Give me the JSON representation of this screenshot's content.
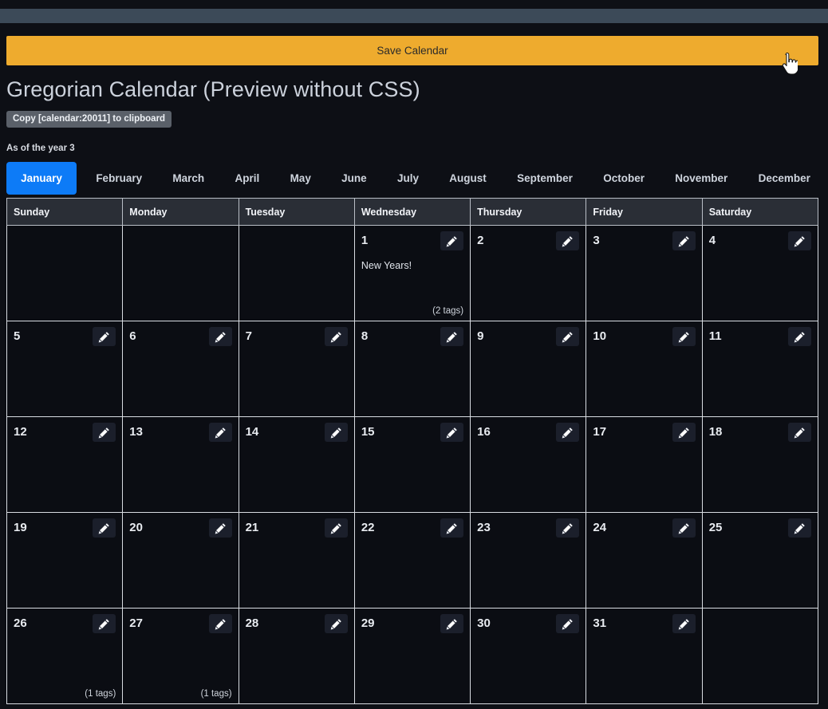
{
  "toolbar": {
    "save_label": "Save Calendar"
  },
  "header": {
    "title": "Gregorian Calendar (Preview without CSS)",
    "copy_label": "Copy [calendar:20011] to clipboard",
    "year_note": "As of the year 3"
  },
  "months": [
    {
      "label": "January",
      "active": true
    },
    {
      "label": "February",
      "active": false
    },
    {
      "label": "March",
      "active": false
    },
    {
      "label": "April",
      "active": false
    },
    {
      "label": "May",
      "active": false
    },
    {
      "label": "June",
      "active": false
    },
    {
      "label": "July",
      "active": false
    },
    {
      "label": "August",
      "active": false
    },
    {
      "label": "September",
      "active": false
    },
    {
      "label": "October",
      "active": false
    },
    {
      "label": "November",
      "active": false
    },
    {
      "label": "December",
      "active": false
    }
  ],
  "weekday_headers": [
    "Sunday",
    "Monday",
    "Tuesday",
    "Wednesday",
    "Thursday",
    "Friday",
    "Saturday"
  ],
  "edit_icon_name": "pencil-edit-icon",
  "weeks": [
    [
      {
        "day": null
      },
      {
        "day": null
      },
      {
        "day": null
      },
      {
        "day": "1",
        "event": "New Years!",
        "tags": "(2 tags)"
      },
      {
        "day": "2"
      },
      {
        "day": "3"
      },
      {
        "day": "4"
      }
    ],
    [
      {
        "day": "5"
      },
      {
        "day": "6"
      },
      {
        "day": "7"
      },
      {
        "day": "8"
      },
      {
        "day": "9"
      },
      {
        "day": "10"
      },
      {
        "day": "11"
      }
    ],
    [
      {
        "day": "12"
      },
      {
        "day": "13"
      },
      {
        "day": "14"
      },
      {
        "day": "15"
      },
      {
        "day": "16"
      },
      {
        "day": "17"
      },
      {
        "day": "18"
      }
    ],
    [
      {
        "day": "19"
      },
      {
        "day": "20"
      },
      {
        "day": "21"
      },
      {
        "day": "22"
      },
      {
        "day": "23"
      },
      {
        "day": "24"
      },
      {
        "day": "25"
      }
    ],
    [
      {
        "day": "26",
        "tags": "(1 tags)"
      },
      {
        "day": "27",
        "tags": "(1 tags)"
      },
      {
        "day": "28"
      },
      {
        "day": "29"
      },
      {
        "day": "30"
      },
      {
        "day": "31"
      },
      {
        "day": null
      }
    ]
  ],
  "colors": {
    "page_bg": "#0d0f15",
    "save_button": "#eeab2e",
    "active_tab": "#0d7bf7",
    "chrome_stripe": "#3c4a58",
    "cell_border": "#d8dce2",
    "header_row": "#2a2e36"
  },
  "cursor": {
    "type": "pointer-hand-cursor"
  }
}
